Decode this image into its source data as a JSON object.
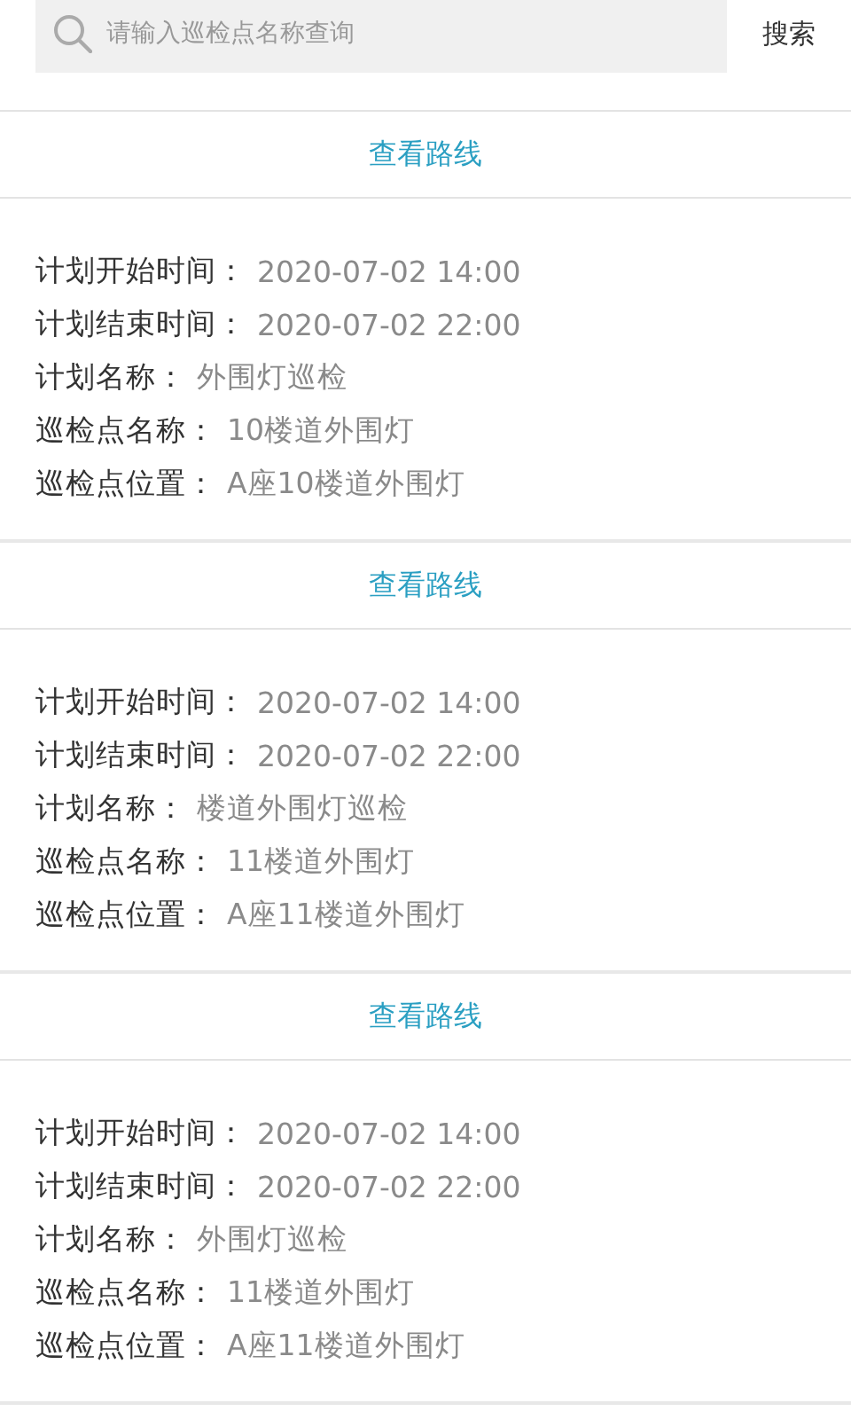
{
  "search": {
    "placeholder": "请输入巡检点名称查询",
    "button": "搜索"
  },
  "records": [
    {
      "route_link": "查看路线",
      "fields": [
        {
          "label": "计划开始时间：",
          "value": "2020-07-02 14:00"
        },
        {
          "label": "计划结束时间：",
          "value": "2020-07-02 22:00"
        },
        {
          "label": "计划名称：",
          "value": "外围灯巡检"
        },
        {
          "label": "巡检点名称：",
          "value": "10楼道外围灯"
        },
        {
          "label": "巡检点位置：",
          "value": "A座10楼道外围灯"
        }
      ]
    },
    {
      "route_link": "查看路线",
      "fields": [
        {
          "label": "计划开始时间：",
          "value": "2020-07-02 14:00"
        },
        {
          "label": "计划结束时间：",
          "value": "2020-07-02 22:00"
        },
        {
          "label": "计划名称：",
          "value": "楼道外围灯巡检"
        },
        {
          "label": "巡检点名称：",
          "value": "11楼道外围灯"
        },
        {
          "label": "巡检点位置：",
          "value": "A座11楼道外围灯"
        }
      ]
    },
    {
      "route_link": "查看路线",
      "fields": [
        {
          "label": "计划开始时间：",
          "value": "2020-07-02 14:00"
        },
        {
          "label": "计划结束时间：",
          "value": "2020-07-02 22:00"
        },
        {
          "label": "计划名称：",
          "value": "外围灯巡检"
        },
        {
          "label": "巡检点名称：",
          "value": "11楼道外围灯"
        },
        {
          "label": "巡检点位置：",
          "value": "A座11楼道外围灯"
        }
      ]
    }
  ]
}
